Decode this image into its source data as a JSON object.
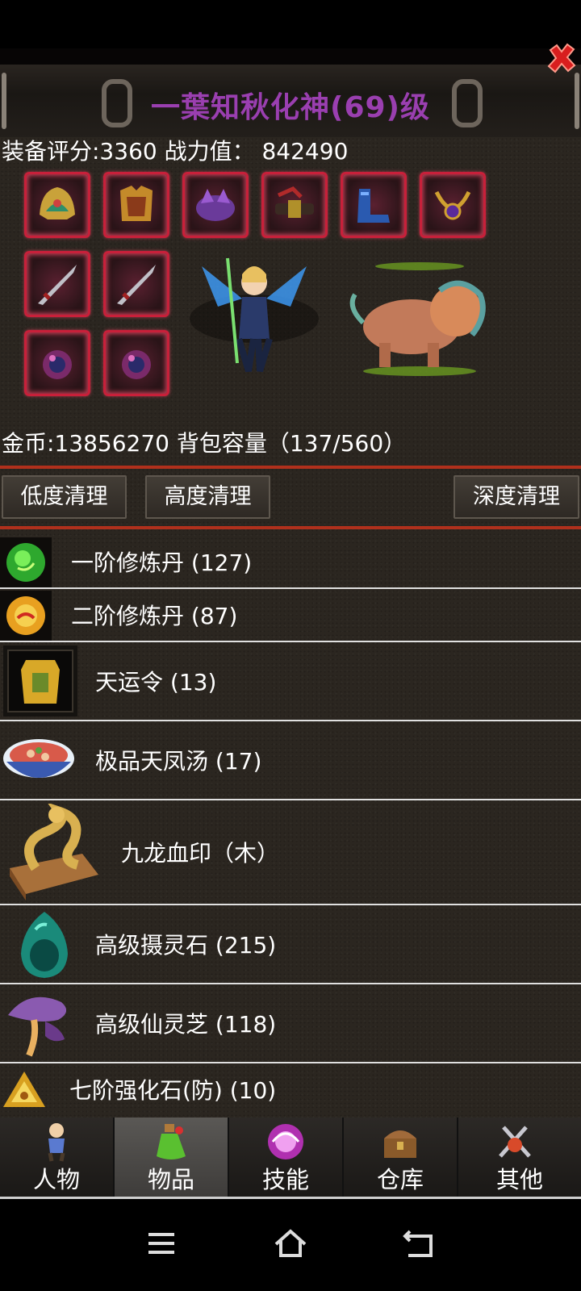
{
  "header": {
    "title": "一葉知秋化神(69)级"
  },
  "stats": {
    "score_line": "装备评分:3360 战力值：  842490"
  },
  "inventory": {
    "gold_line": "金币:13856270 背包容量（137/560）"
  },
  "clean_buttons": {
    "low": "低度清理",
    "high": "高度清理",
    "deep": "深度清理"
  },
  "items": [
    {
      "name": "一阶修炼丹 (127)",
      "icon": "green-pill-icon"
    },
    {
      "name": "二阶修炼丹 (87)",
      "icon": "orange-pill-icon"
    },
    {
      "name": "天运令 (13)",
      "icon": "golden-token-icon"
    },
    {
      "name": "极品天凤汤 (17)",
      "icon": "soup-bowl-icon"
    },
    {
      "name": "九龙血印（木）",
      "icon": "dragon-seal-icon"
    },
    {
      "name": "高级摄灵石 (215)",
      "icon": "spirit-stone-icon"
    },
    {
      "name": "高级仙灵芝 (118)",
      "icon": "lingzhi-mushroom-icon"
    },
    {
      "name": "七阶强化石(防) (10)",
      "icon": "enhance-stone-icon"
    }
  ],
  "tabs": [
    {
      "label": "人物",
      "icon": "character-icon"
    },
    {
      "label": "物品",
      "icon": "items-potion-icon"
    },
    {
      "label": "技能",
      "icon": "skill-orb-icon"
    },
    {
      "label": "仓库",
      "icon": "treasure-chest-icon"
    },
    {
      "label": "其他",
      "icon": "other-swords-icon"
    }
  ],
  "active_tab": "物品",
  "colors": {
    "title": "#9a3fb0",
    "separator": "#b0301c",
    "slot_border": "#c8203a"
  }
}
